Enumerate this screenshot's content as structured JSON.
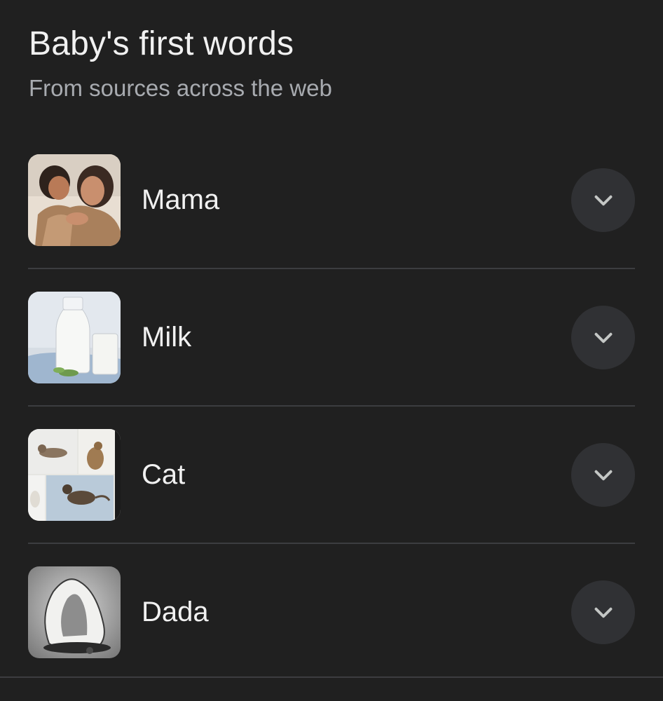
{
  "header": {
    "title": "Baby's first words",
    "subtitle": "From sources across the web"
  },
  "items": [
    {
      "label": "Mama",
      "image": "mother-and-child-photo",
      "icon": "chevron-down-icon"
    },
    {
      "label": "Milk",
      "image": "milk-bottle-and-glass-photo",
      "icon": "chevron-down-icon"
    },
    {
      "label": "Cat",
      "image": "cat-collage-photo",
      "icon": "chevron-down-icon"
    },
    {
      "label": "Dada",
      "image": "fountain-sculpture-photo",
      "icon": "chevron-down-icon"
    }
  ],
  "colors": {
    "background": "#202020",
    "button_bg": "#303134",
    "divider": "#3c3d40",
    "chevron": "#c4c7c5",
    "subtitle": "#a8abb0"
  }
}
